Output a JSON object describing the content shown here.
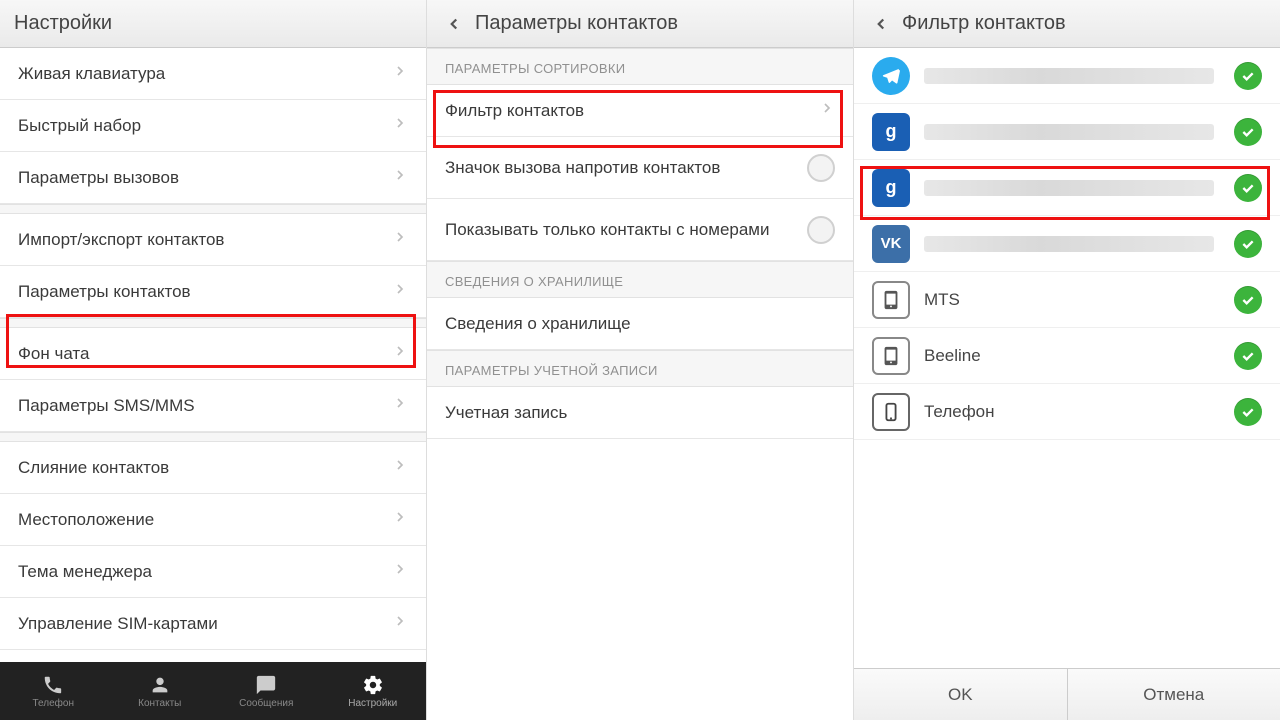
{
  "pane1": {
    "title": "Настройки",
    "items": [
      "Живая клавиатура",
      "Быстрый набор",
      "Параметры вызовов",
      "Импорт/экспорт контактов",
      "Параметры контактов",
      "Фон чата",
      "Параметры SMS/MMS",
      "Слияние контактов",
      "Местоположение",
      "Тема менеджера",
      "Управление SIM-картами"
    ],
    "nav": [
      "Телефон",
      "Контакты",
      "Сообщения",
      "Настройки"
    ]
  },
  "pane2": {
    "title": "Параметры контактов",
    "section1": "ПАРАМЕТРЫ СОРТИРОВКИ",
    "filter": "Фильтр контактов",
    "callIcon": "Значок вызова напротив контактов",
    "onlyNumbers": "Показывать только контакты с номерами",
    "section2": "СВЕДЕНИЯ О ХРАНИЛИЩЕ",
    "storage": "Сведения о хранилище",
    "section3": "ПАРАМЕТРЫ УЧЕТНОЙ ЗАПИСИ",
    "account": "Учетная запись"
  },
  "pane3": {
    "title": "Фильтр контактов",
    "accounts": {
      "mts": "MTS",
      "beeline": "Beeline",
      "phone": "Телефон"
    },
    "ok": "OK",
    "cancel": "Отмена"
  }
}
